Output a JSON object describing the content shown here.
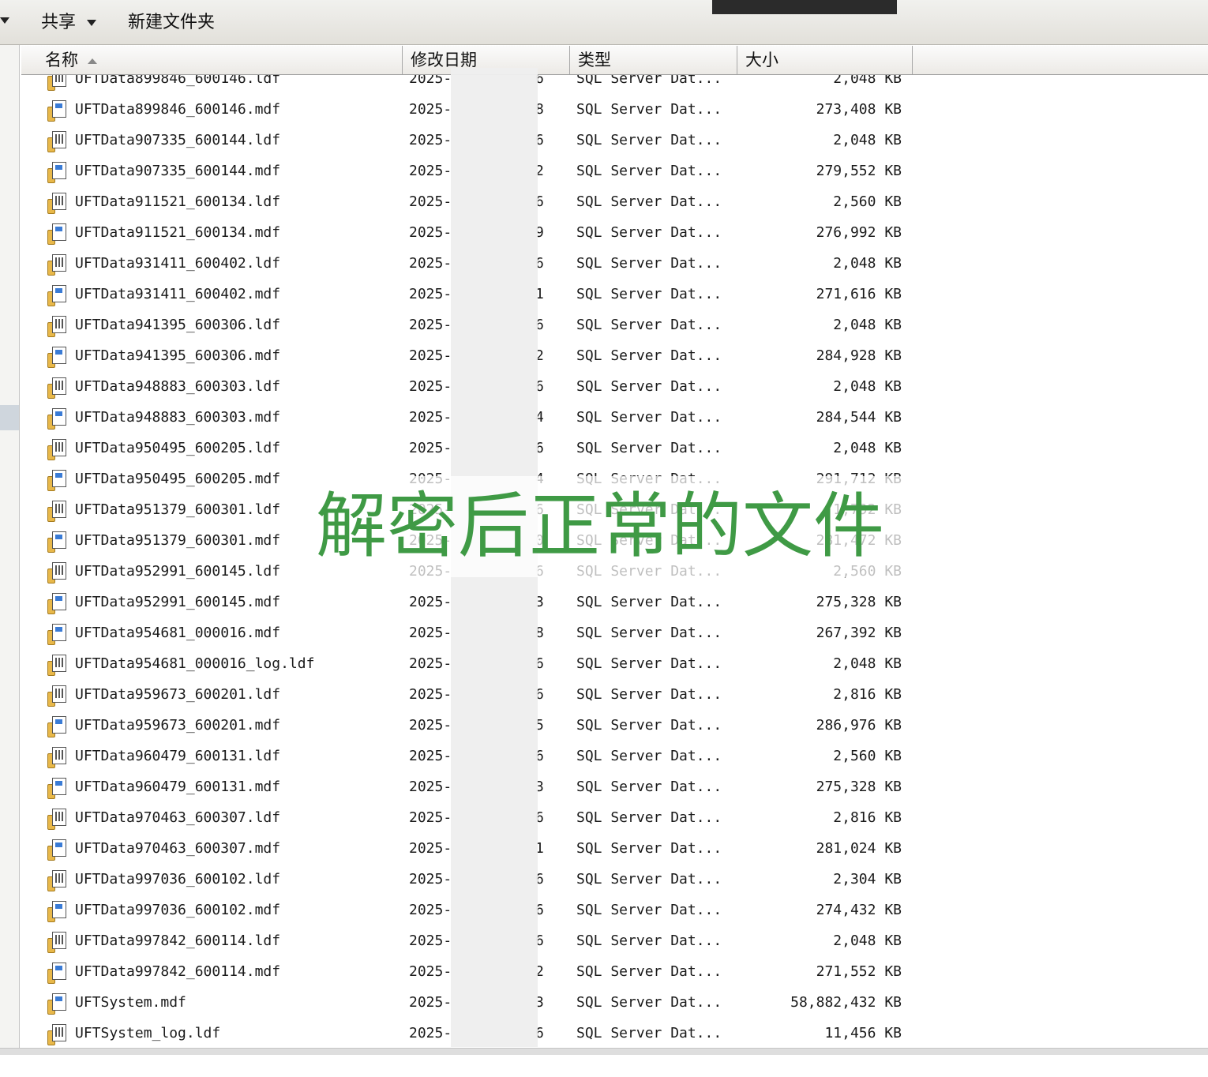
{
  "toolbar": {
    "share_label": "共享",
    "new_folder_label": "新建文件夹"
  },
  "columns": {
    "name": "名称",
    "date": "修改日期",
    "type": "类型",
    "size": "大小"
  },
  "files": [
    {
      "name": "UFTData899846_600146.ldf",
      "date": "2025-",
      "tail": "6",
      "type": "SQL Server Dat...",
      "size": "2,048 KB",
      "icon": "ldf-file-icon"
    },
    {
      "name": "UFTData899846_600146.mdf",
      "date": "2025-",
      "tail": "8",
      "type": "SQL Server Dat...",
      "size": "273,408 KB",
      "icon": "mdf-file-icon"
    },
    {
      "name": "UFTData907335_600144.ldf",
      "date": "2025-",
      "tail": "6",
      "type": "SQL Server Dat...",
      "size": "2,048 KB",
      "icon": "ldf-file-icon"
    },
    {
      "name": "UFTData907335_600144.mdf",
      "date": "2025-",
      "tail": "2",
      "type": "SQL Server Dat...",
      "size": "279,552 KB",
      "icon": "mdf-file-icon"
    },
    {
      "name": "UFTData911521_600134.ldf",
      "date": "2025-",
      "tail": "6",
      "type": "SQL Server Dat...",
      "size": "2,560 KB",
      "icon": "ldf-file-icon"
    },
    {
      "name": "UFTData911521_600134.mdf",
      "date": "2025-",
      "tail": "9",
      "type": "SQL Server Dat...",
      "size": "276,992 KB",
      "icon": "mdf-file-icon"
    },
    {
      "name": "UFTData931411_600402.ldf",
      "date": "2025-",
      "tail": "6",
      "type": "SQL Server Dat...",
      "size": "2,048 KB",
      "icon": "ldf-file-icon"
    },
    {
      "name": "UFTData931411_600402.mdf",
      "date": "2025-",
      "tail": "1",
      "type": "SQL Server Dat...",
      "size": "271,616 KB",
      "icon": "mdf-file-icon"
    },
    {
      "name": "UFTData941395_600306.ldf",
      "date": "2025-",
      "tail": "6",
      "type": "SQL Server Dat...",
      "size": "2,048 KB",
      "icon": "ldf-file-icon"
    },
    {
      "name": "UFTData941395_600306.mdf",
      "date": "2025-",
      "tail": "2",
      "type": "SQL Server Dat...",
      "size": "284,928 KB",
      "icon": "mdf-file-icon"
    },
    {
      "name": "UFTData948883_600303.ldf",
      "date": "2025-",
      "tail": "6",
      "type": "SQL Server Dat...",
      "size": "2,048 KB",
      "icon": "ldf-file-icon"
    },
    {
      "name": "UFTData948883_600303.mdf",
      "date": "2025-",
      "tail": "4",
      "type": "SQL Server Dat...",
      "size": "284,544 KB",
      "icon": "mdf-file-icon"
    },
    {
      "name": "UFTData950495_600205.ldf",
      "date": "2025-",
      "tail": "6",
      "type": "SQL Server Dat...",
      "size": "2,048 KB",
      "icon": "ldf-file-icon"
    },
    {
      "name": "UFTData950495_600205.mdf",
      "date": "2025-",
      "tail": "4",
      "type": "SQL Server Dat...",
      "size": "291,712 KB",
      "icon": "mdf-file-icon"
    },
    {
      "name": "UFTData951379_600301.ldf",
      "date": "2025-",
      "tail": "6",
      "type": "SQL Server Dat...",
      "size": "1,792 KB",
      "icon": "ldf-file-icon"
    },
    {
      "name": "UFTData951379_600301.mdf",
      "date": "2025-",
      "tail": "0",
      "type": "SQL Server Dat...",
      "size": "281,472 KB",
      "icon": "mdf-file-icon"
    },
    {
      "name": "UFTData952991_600145.ldf",
      "date": "2025-",
      "tail": "6",
      "type": "SQL Server Dat...",
      "size": "2,560 KB",
      "icon": "ldf-file-icon"
    },
    {
      "name": "UFTData952991_600145.mdf",
      "date": "2025-",
      "tail": "3",
      "type": "SQL Server Dat...",
      "size": "275,328 KB",
      "icon": "mdf-file-icon"
    },
    {
      "name": "UFTData954681_000016.mdf",
      "date": "2025-",
      "tail": "8",
      "type": "SQL Server Dat...",
      "size": "267,392 KB",
      "icon": "mdf-file-icon"
    },
    {
      "name": "UFTData954681_000016_log.ldf",
      "date": "2025-",
      "tail": "6",
      "type": "SQL Server Dat...",
      "size": "2,048 KB",
      "icon": "ldf-file-icon"
    },
    {
      "name": "UFTData959673_600201.ldf",
      "date": "2025-",
      "tail": "6",
      "type": "SQL Server Dat...",
      "size": "2,816 KB",
      "icon": "ldf-file-icon"
    },
    {
      "name": "UFTData959673_600201.mdf",
      "date": "2025-",
      "tail": "5",
      "type": "SQL Server Dat...",
      "size": "286,976 KB",
      "icon": "mdf-file-icon"
    },
    {
      "name": "UFTData960479_600131.ldf",
      "date": "2025-",
      "tail": "6",
      "type": "SQL Server Dat...",
      "size": "2,560 KB",
      "icon": "ldf-file-icon"
    },
    {
      "name": "UFTData960479_600131.mdf",
      "date": "2025-",
      "tail": "3",
      "type": "SQL Server Dat...",
      "size": "275,328 KB",
      "icon": "mdf-file-icon"
    },
    {
      "name": "UFTData970463_600307.ldf",
      "date": "2025-",
      "tail": "6",
      "type": "SQL Server Dat...",
      "size": "2,816 KB",
      "icon": "ldf-file-icon"
    },
    {
      "name": "UFTData970463_600307.mdf",
      "date": "2025-",
      "tail": "1",
      "type": "SQL Server Dat...",
      "size": "281,024 KB",
      "icon": "mdf-file-icon"
    },
    {
      "name": "UFTData997036_600102.ldf",
      "date": "2025-",
      "tail": "6",
      "type": "SQL Server Dat...",
      "size": "2,304 KB",
      "icon": "ldf-file-icon"
    },
    {
      "name": "UFTData997036_600102.mdf",
      "date": "2025-",
      "tail": "6",
      "type": "SQL Server Dat...",
      "size": "274,432 KB",
      "icon": "mdf-file-icon"
    },
    {
      "name": "UFTData997842_600114.ldf",
      "date": "2025-",
      "tail": "6",
      "type": "SQL Server Dat...",
      "size": "2,048 KB",
      "icon": "ldf-file-icon"
    },
    {
      "name": "UFTData997842_600114.mdf",
      "date": "2025-",
      "tail": "2",
      "type": "SQL Server Dat...",
      "size": "271,552 KB",
      "icon": "mdf-file-icon"
    },
    {
      "name": "UFTSystem.mdf",
      "date": "2025-",
      "tail": "3",
      "type": "SQL Server Dat...",
      "size": "58,882,432 KB",
      "icon": "mdf-file-icon"
    },
    {
      "name": "UFTSystem_log.ldf",
      "date": "2025-",
      "tail": "6",
      "type": "SQL Server Dat...",
      "size": "11,456 KB",
      "icon": "ldf-file-icon"
    }
  ],
  "overlay": {
    "caption": "解密后正常的文件",
    "color": "#3f9a45"
  }
}
